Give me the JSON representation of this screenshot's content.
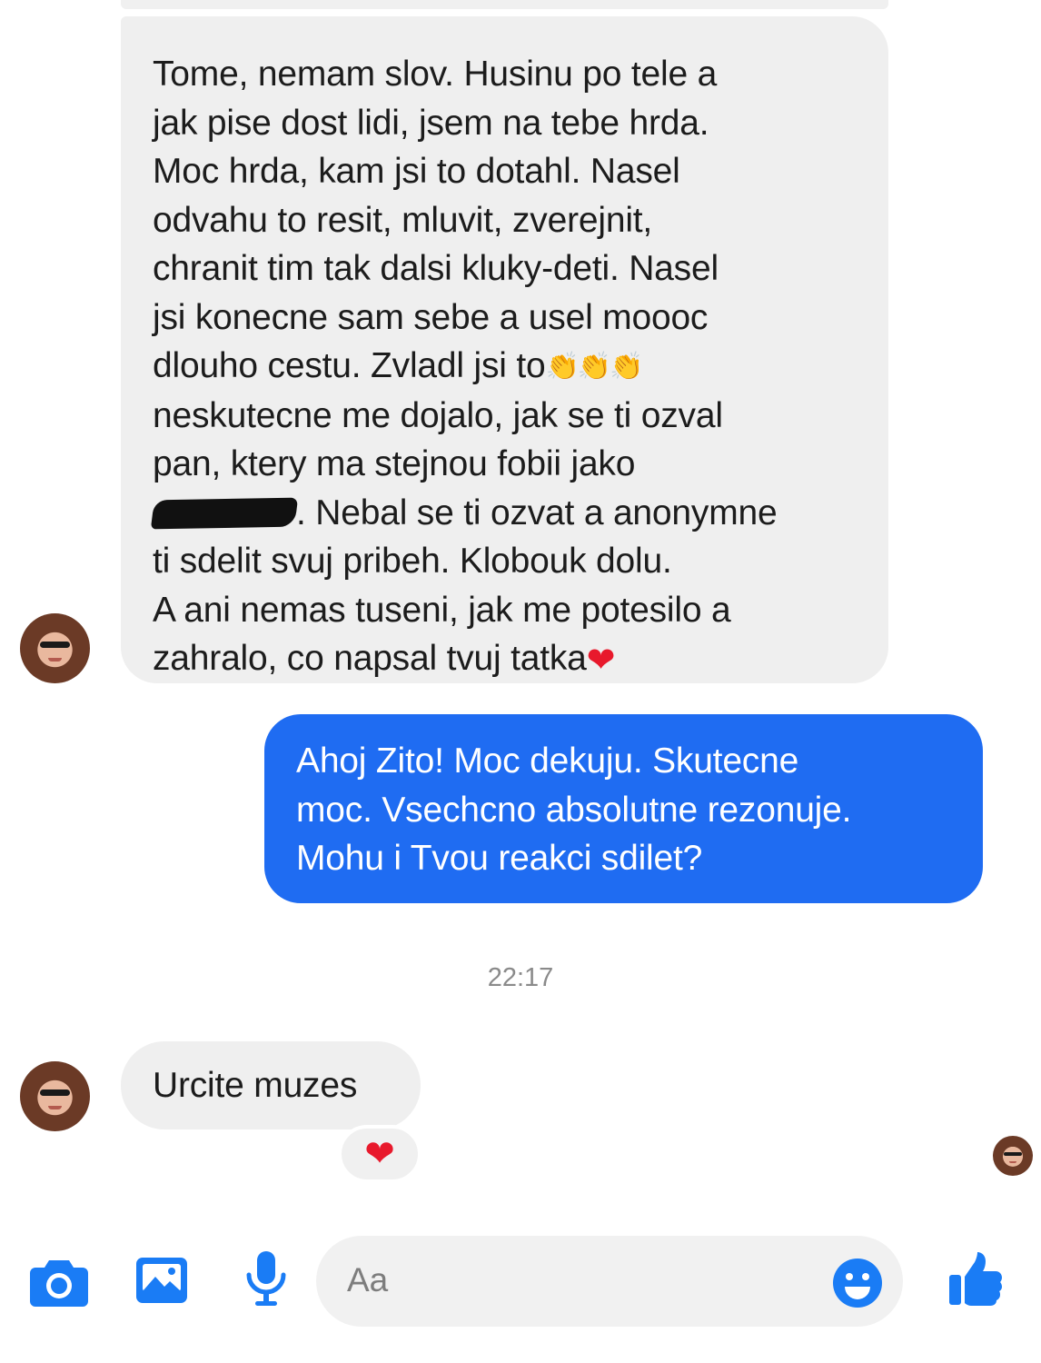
{
  "conversation": {
    "messages": [
      {
        "direction": "incoming",
        "lines": [
          "Tome, nemam slov. Husinu po tele a",
          "jak pise dost lidi, jsem na tebe hrda.",
          "Moc hrda, kam jsi to dotahl. Nasel",
          "odvahu to resit, mluvit, zverejnit,",
          "chranit tim tak dalsi kluky-deti. Nasel",
          "jsi konecne sam sebe a usel moooc",
          "dlouho cestu. Zvladl jsi to",
          "neskutecne me dojalo, jak se ti ozval",
          "pan, ktery ma stejnou fobii jako",
          ". Nebal se ti ozvat a anonymne",
          "ti sdelit svuj pribeh. Klobouk dolu.",
          "A ani nemas tuseni, jak me potesilo a",
          "zahralo, co napsal tvuj tatka"
        ],
        "inline_emoji": {
          "clapping": "👏👏👏",
          "heart": "❤"
        },
        "redacted_name": true
      },
      {
        "direction": "outgoing",
        "lines": [
          "Ahoj Zito! Moc dekuju. Skutecne",
          "moc. Vsechcno absolutne rezonuje.",
          "Mohu i Tvou reakci sdilet?"
        ]
      },
      {
        "direction": "incoming",
        "lines": [
          "Urcite muzes"
        ],
        "reaction": "❤"
      }
    ],
    "timestamp": "22:17"
  },
  "composer": {
    "placeholder": "Aa",
    "icons": [
      "camera-icon",
      "gallery-icon",
      "microphone-icon",
      "emoji-icon",
      "thumbs-up-icon"
    ]
  },
  "colors": {
    "accent": "#1a7cf5",
    "outgoing_bubble": "#1f6cf2",
    "incoming_bubble": "#efefef",
    "heart": "#e8192c"
  }
}
